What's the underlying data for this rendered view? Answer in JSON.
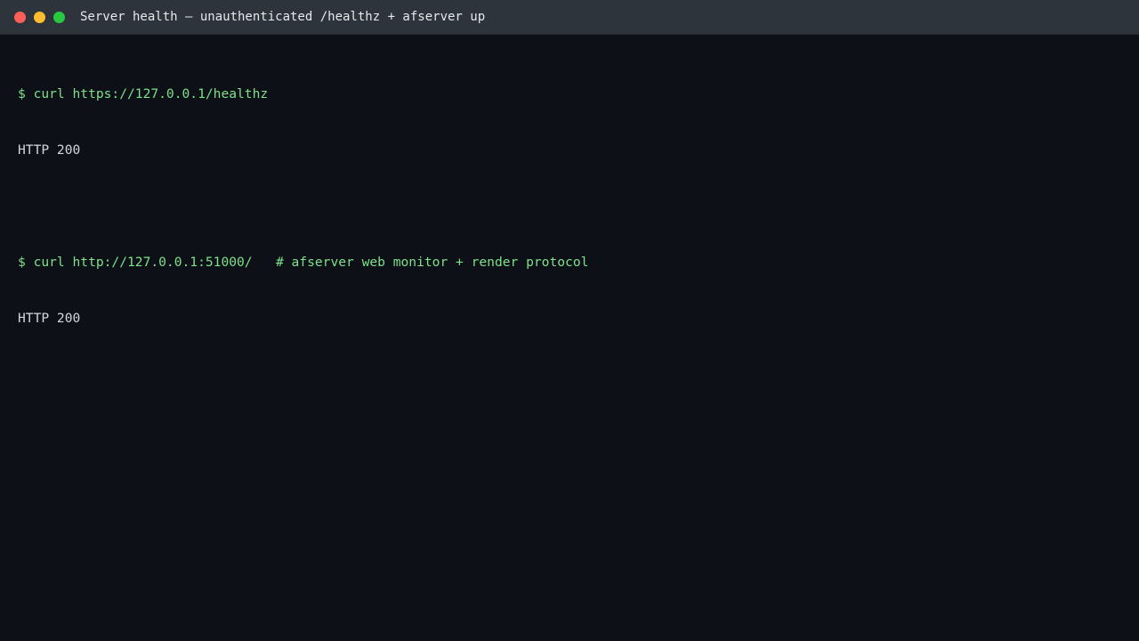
{
  "window": {
    "title": "Server health — unauthenticated /healthz + afserver up",
    "colors": {
      "close": "#ff5f57",
      "minimize": "#febc2e",
      "maximize": "#28c840",
      "titlebar": "#2e343c",
      "background": "#0d1017",
      "command": "#7ee08a",
      "output": "#d4d8de"
    }
  },
  "terminal": {
    "lines": [
      {
        "type": "command",
        "text": "$ curl https://127.0.0.1/healthz"
      },
      {
        "type": "output",
        "text": "HTTP 200"
      },
      {
        "type": "blank",
        "text": ""
      },
      {
        "type": "command",
        "text": "$ curl http://127.0.0.1:51000/   # afserver web monitor + render protocol"
      },
      {
        "type": "output",
        "text": "HTTP 200"
      }
    ]
  }
}
